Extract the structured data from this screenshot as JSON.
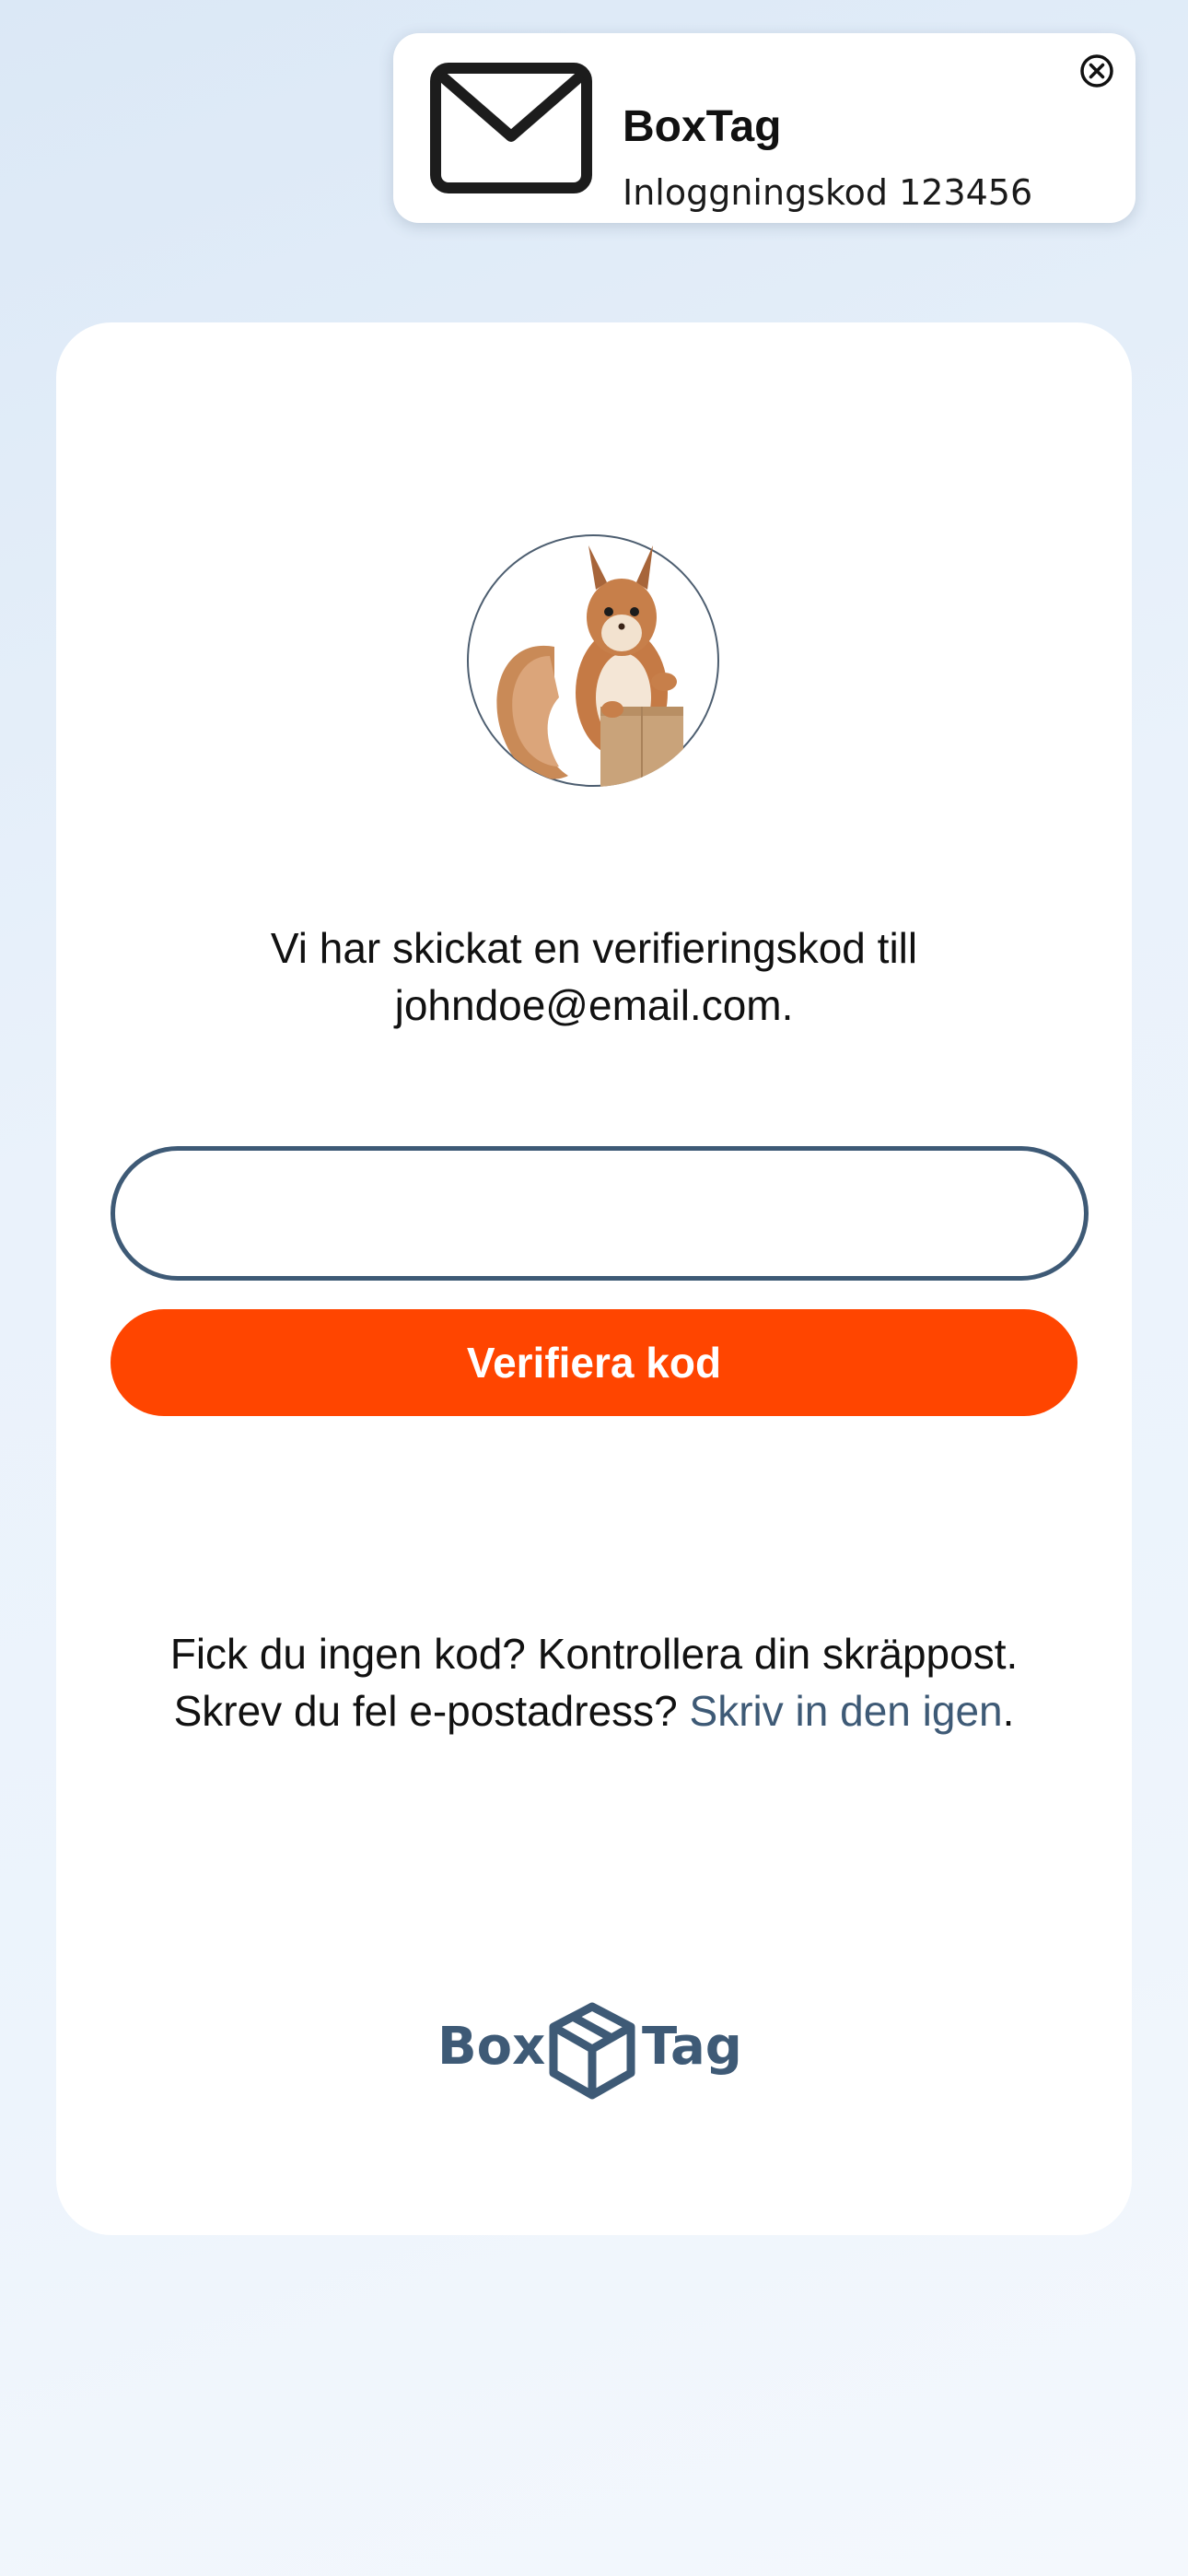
{
  "notification": {
    "app_name": "BoxTag",
    "message": "Inloggningskod 123456",
    "icon": "mail-icon",
    "close_icon": "close-circle-icon"
  },
  "card": {
    "avatar_icon": "squirrel-with-box-image",
    "message_line1": "Vi har skickat en verifieringskod till",
    "message_line2": "johndoe@email.com.",
    "code_input": {
      "value": "",
      "placeholder": ""
    },
    "verify_button_label": "Verifiera kod",
    "help": {
      "line1": "Fick du ingen kod? Kontrollera din skräppost.",
      "line2_prefix": "Skrev du fel e-postadress? ",
      "line2_link": "Skriv in den igen",
      "line2_suffix": "."
    },
    "logo": {
      "left": "Box",
      "right": "Tag",
      "icon": "box-icon"
    }
  },
  "colors": {
    "accent": "#ff4500",
    "brand": "#3e5a76",
    "text": "#111111",
    "card_background": "#ffffff",
    "page_background": "#e6eff9"
  }
}
